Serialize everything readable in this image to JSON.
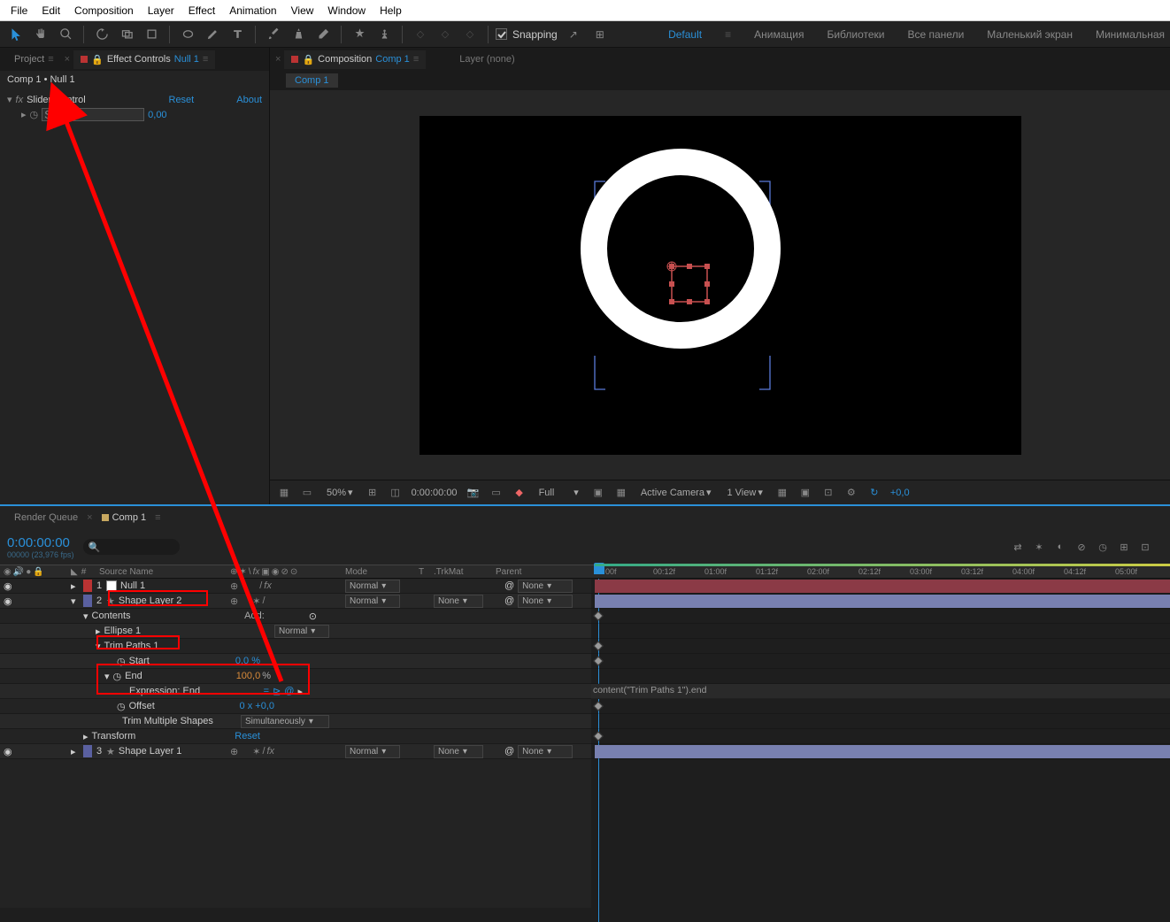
{
  "menus": [
    "File",
    "Edit",
    "Composition",
    "Layer",
    "Effect",
    "Animation",
    "View",
    "Window",
    "Help"
  ],
  "snapping": "Snapping",
  "workspaces": {
    "active": "Default",
    "items": [
      "Анимация",
      "Библиотеки",
      "Все панели",
      "Маленький экран",
      "Минимальная"
    ]
  },
  "project_tab": "Project",
  "ec_tab_prefix": "Effect Controls ",
  "ec_tab_layer": "Null 1",
  "ec_breadcrumb": "Comp 1 • Null 1",
  "effect_name": "Slider Control",
  "reset": "Reset",
  "about": "About",
  "slider_param": "Slider",
  "slider_value": "0,00",
  "comp_tab_prefix": "Composition ",
  "comp_name": "Comp 1",
  "layer_none": "Layer (none)",
  "viewer_footer": {
    "zoom": "50%",
    "time": "0:00:00:00",
    "res": "Full",
    "camera": "Active Camera",
    "view": "1 View",
    "exposure": "+0,0"
  },
  "render_queue": "Render Queue",
  "tl_time": "0:00:00:00",
  "tl_time_sub": "00000 (23,976 fps)",
  "col_source": "Source Name",
  "col_mode": "Mode",
  "col_t": "T",
  "col_trk": ".TrkMat",
  "col_parent": "Parent",
  "layers": {
    "null": {
      "num": "1",
      "name": "Null 1",
      "mode": "Normal",
      "parent": "None"
    },
    "shape2": {
      "num": "2",
      "name": "Shape Layer 2",
      "mode": "Normal",
      "trk": "None",
      "parent": "None"
    },
    "contents": "Contents",
    "add": "Add:",
    "ellipse": "Ellipse 1",
    "ellipse_mode": "Normal",
    "trim": "Trim Paths 1",
    "start": "Start",
    "start_val": "0,0 %",
    "end": "End",
    "end_val": "100,0",
    "end_pct": "%",
    "expr": "Expression: End",
    "offset": "Offset",
    "offset_val": "0 x +0,0",
    "trim_mult": "Trim Multiple Shapes",
    "trim_mult_val": "Simultaneously",
    "transform": "Transform",
    "transform_reset": "Reset",
    "shape1": {
      "num": "3",
      "name": "Shape Layer 1",
      "mode": "Normal",
      "trk": "None",
      "parent": "None"
    }
  },
  "expression_text": "content(\"Trim Paths 1\").end",
  "time_ticks": [
    "00f",
    "00:12f",
    "01:00f",
    "01:12f",
    "02:00f",
    "02:12f",
    "03:00f",
    "03:12f",
    "04:00f",
    "04:12f",
    "05:00f"
  ]
}
